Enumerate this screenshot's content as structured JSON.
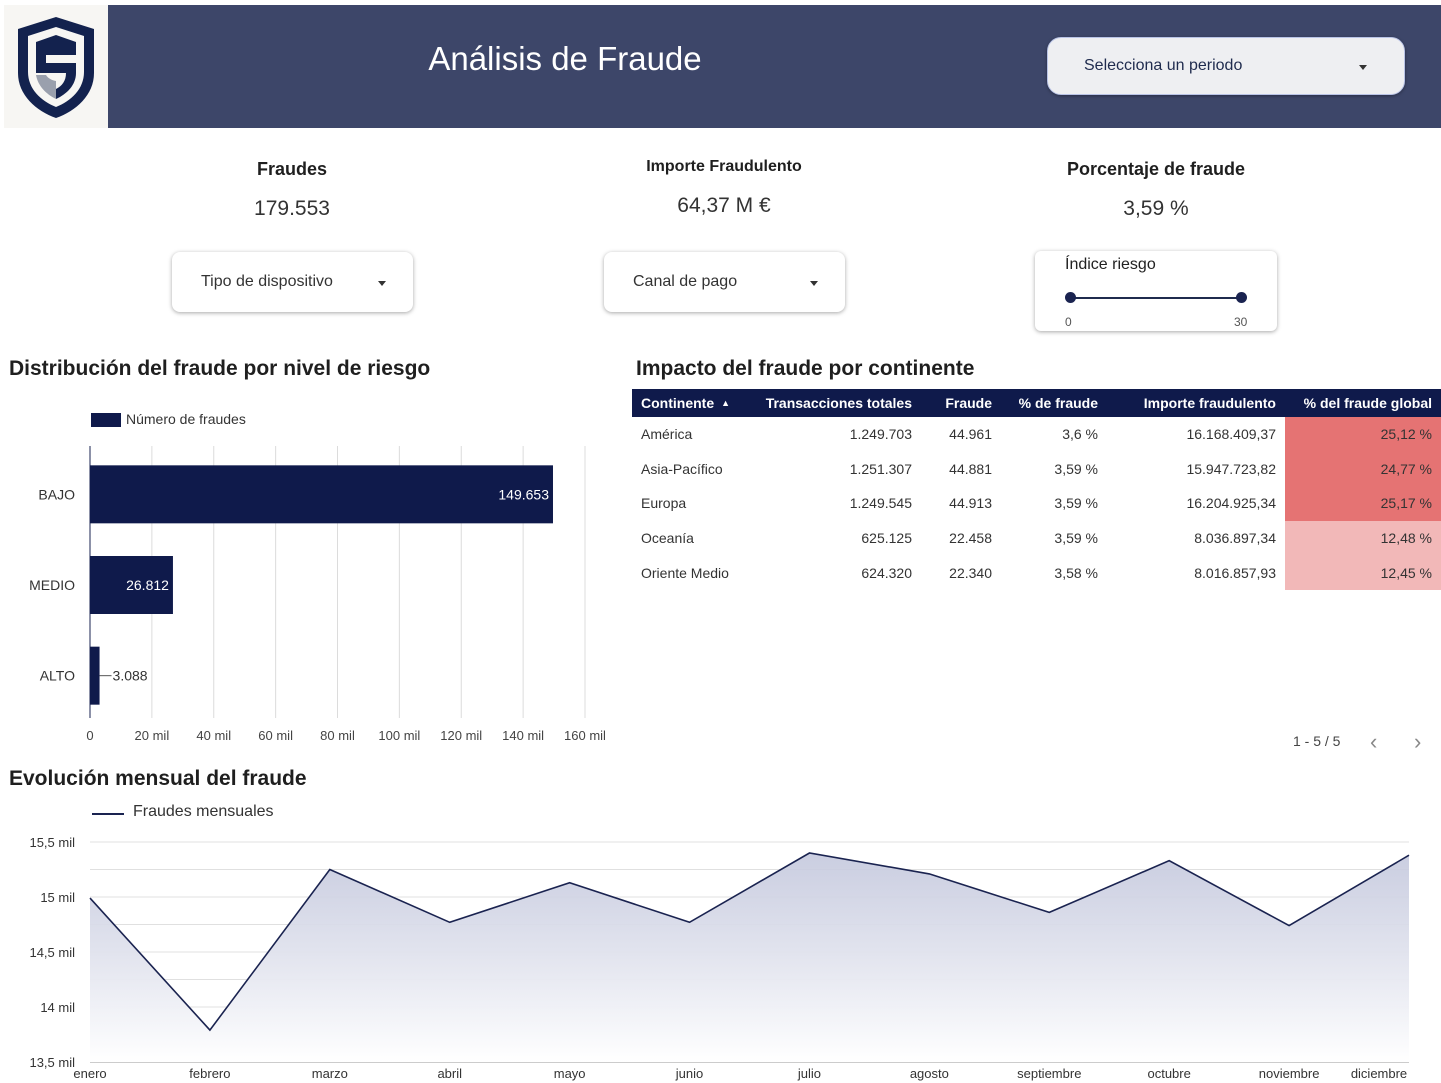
{
  "header": {
    "title": "Análisis de Fraude",
    "period_placeholder": "Selecciona un periodo"
  },
  "kpis": [
    {
      "title": "Fraudes",
      "value": "179.553"
    },
    {
      "title": "Importe Fraudulento",
      "value": "64,37 M €"
    },
    {
      "title": "Porcentaje de fraude",
      "value": "3,59 %"
    }
  ],
  "filters": {
    "device": "Tipo de dispositivo",
    "channel": "Canal de pago",
    "risk_slider": {
      "label": "Índice riesgo",
      "min": "0",
      "max": "30"
    }
  },
  "risk_chart_title": "Distribución del fraude por nivel de riesgo",
  "table": {
    "title": "Impacto del fraude por continente",
    "columns": [
      "Continente",
      "Transacciones totales",
      "Fraude",
      "% de fraude",
      "Importe fraudulento",
      "% del fraude global"
    ],
    "rows": [
      [
        "América",
        "1.249.703",
        "44.961",
        "3,6 %",
        "16.168.409,37",
        "25,12 %"
      ],
      [
        "Asia-Pacífico",
        "1.251.307",
        "44.881",
        "3,59 %",
        "15.947.723,82",
        "24,77 %"
      ],
      [
        "Europa",
        "1.249.545",
        "44.913",
        "3,59 %",
        "16.204.925,34",
        "25,17 %"
      ],
      [
        "Oceanía",
        "625.125",
        "22.458",
        "3,59 %",
        "8.036.897,34",
        "12,48 %"
      ],
      [
        "Oriente Medio",
        "624.320",
        "22.340",
        "3,58 %",
        "8.016.857,93",
        "12,45 %"
      ]
    ],
    "pagination": "1 - 5 / 5"
  },
  "monthly_chart_title": "Evolución mensual del fraude",
  "chart_data": [
    {
      "type": "bar",
      "orientation": "horizontal",
      "categories": [
        "BAJO",
        "MEDIO",
        "ALTO"
      ],
      "series": [
        {
          "name": "Número de fraudes",
          "values": [
            149653,
            26812,
            3088
          ]
        }
      ],
      "data_labels": [
        "149.653",
        "26.812",
        "3.088"
      ],
      "xlim": [
        0,
        160000
      ],
      "x_ticks": [
        "0",
        "20 mil",
        "40 mil",
        "60 mil",
        "80 mil",
        "100 mil",
        "120 mil",
        "140 mil",
        "160 mil"
      ],
      "grid": true,
      "legend": "top-left",
      "color": "#0f1a4b"
    },
    {
      "type": "area",
      "categories": [
        "enero",
        "febrero",
        "marzo",
        "abril",
        "mayo",
        "junio",
        "julio",
        "agosto",
        "septiembre",
        "octubre",
        "noviembre",
        "diciembre"
      ],
      "series": [
        {
          "name": "Fraudes mensuales",
          "values": [
            14990,
            13790,
            15250,
            14770,
            15130,
            14770,
            15400,
            15210,
            14860,
            15330,
            14740,
            15380
          ]
        }
      ],
      "ylim": [
        13500,
        15500
      ],
      "y_ticks": [
        "13,5 mil",
        "14 mil",
        "14,5 mil",
        "15 mil",
        "15,5 mil"
      ],
      "grid": true,
      "legend": "top-left",
      "color": "#1a2350"
    }
  ]
}
